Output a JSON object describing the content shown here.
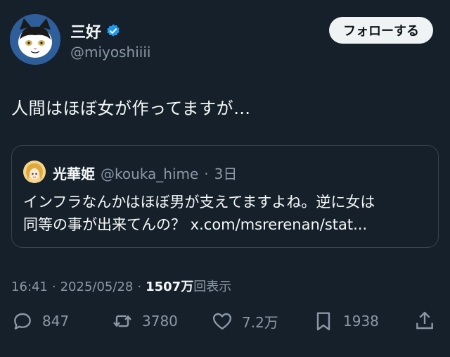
{
  "author": {
    "display_name": "三好",
    "handle": "@miyoshiiii",
    "verified": true
  },
  "follow_button": "フォローする",
  "tweet_text": "人間はほぼ女が作ってますが…",
  "quote": {
    "display_name": "光華姫",
    "handle": "@kouka_hime",
    "dot": "·",
    "time": "3日",
    "text_line1": "インフラなんかはほぼ男が支えてますよね。逆に女は",
    "text_line2": "同等の事が出来てんの？ x.com/msrerenan/stat..."
  },
  "meta": {
    "time": "16:41",
    "sep1": "·",
    "date": "2025/05/28",
    "sep2": "·",
    "views_count": "1507万",
    "views_label": "回表示"
  },
  "actions": {
    "replies": "847",
    "reposts": "3780",
    "likes": "7.2万",
    "bookmarks": "1938"
  },
  "icons": {
    "verified": "verified-badge-icon",
    "reply": "reply-icon",
    "repost": "repost-icon",
    "like": "heart-icon",
    "bookmark": "bookmark-icon",
    "share": "share-icon"
  },
  "colors": {
    "background": "#15202b",
    "verified": "#1d9bf0",
    "secondary_text": "#8b98a5",
    "border": "#38444d"
  }
}
